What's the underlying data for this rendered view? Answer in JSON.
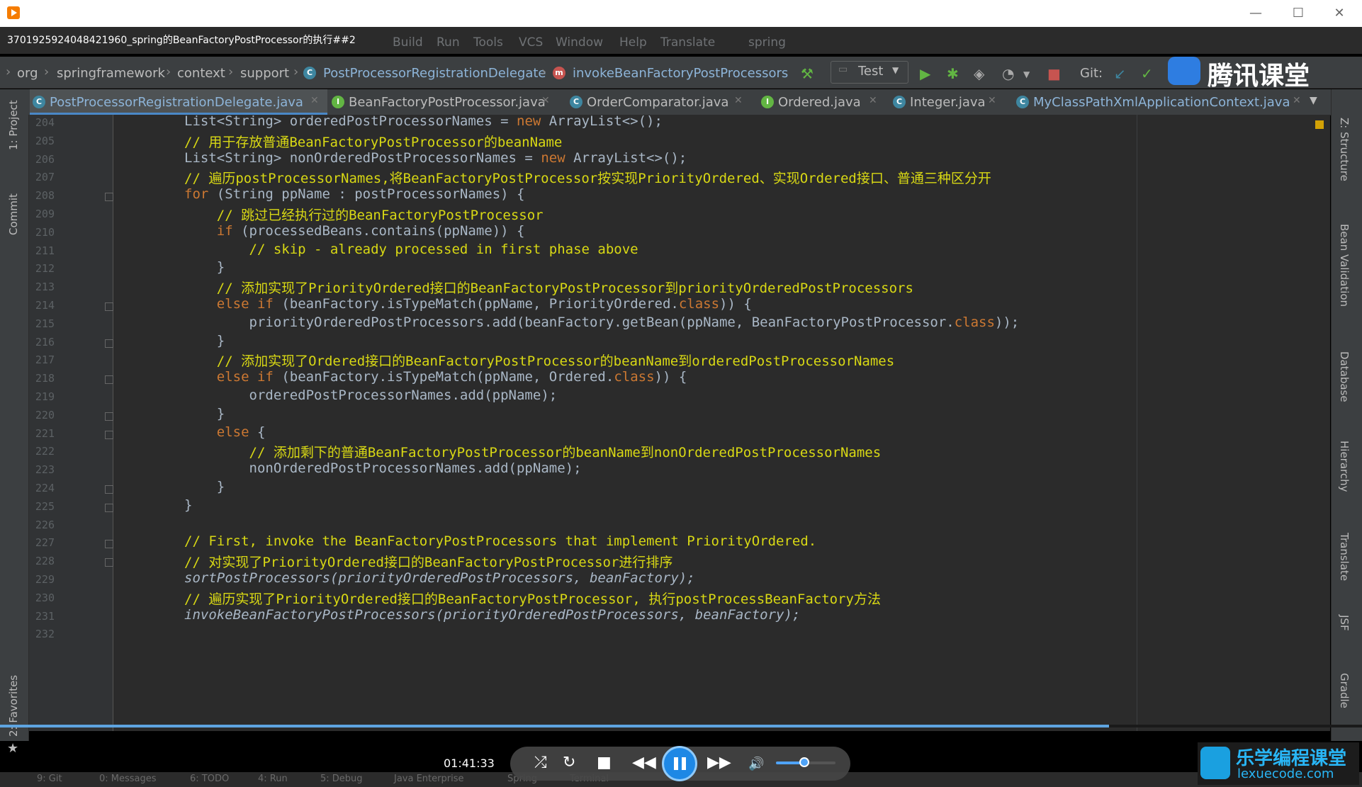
{
  "player": {
    "title": "3701925924048421960_spring的BeanFactoryPostProcessor的执行##2",
    "time": "01:41:33",
    "progress": 0.814,
    "volume": 0.48,
    "win_controls": [
      "—",
      "☐",
      "✕"
    ]
  },
  "ide": {
    "menu": [
      "Build",
      "Run",
      "Tools",
      "VCS",
      "Window",
      "Help",
      "Translate",
      "spring"
    ],
    "breadcrumbs": [
      "org",
      "springframework",
      "context",
      "support",
      "PostProcessorRegistrationDelegate",
      "invokeBeanFactoryPostProcessors"
    ],
    "run_config": "Test",
    "git_label": "Git:",
    "tabs": [
      {
        "label": "PostProcessorRegistrationDelegate.java",
        "icon": "C",
        "active": true
      },
      {
        "label": "BeanFactoryPostProcessor.java",
        "icon": "I",
        "active": false
      },
      {
        "label": "OrderComparator.java",
        "icon": "C",
        "active": false
      },
      {
        "label": "Ordered.java",
        "icon": "I",
        "active": false
      },
      {
        "label": "Integer.java",
        "icon": "C",
        "active": false
      },
      {
        "label": "MyClassPathXmlApplicationContext.java",
        "icon": "C",
        "active": false
      }
    ],
    "left_tools": [
      "1: Project",
      "Commit",
      "2: Favorites"
    ],
    "right_tools": [
      "Z: Structure",
      "Bean Validation",
      "Database",
      "Hierarchy",
      "Translate",
      "JSF",
      "Gradle"
    ],
    "line_numbers": [
      "204",
      "205",
      "206",
      "207",
      "208",
      "209",
      "210",
      "211",
      "212",
      "213",
      "214",
      "215",
      "216",
      "217",
      "218",
      "219",
      "220",
      "221",
      "222",
      "223",
      "224",
      "225",
      "226",
      "227",
      "228",
      "229",
      "230",
      "231",
      "232"
    ],
    "code_lines": [
      "List<String> orderedPostProcessorNames = new ArrayList<>();",
      "// 用于存放普通BeanFactoryPostProcessor的beanName",
      "List<String> nonOrderedPostProcessorNames = new ArrayList<>();",
      "// 遍历postProcessorNames,将BeanFactoryPostProcessor按实现PriorityOrdered、实现Ordered接口、普通三种区分开",
      "for (String ppName : postProcessorNames) {",
      "    // 跳过已经执行过的BeanFactoryPostProcessor",
      "    if (processedBeans.contains(ppName)) {",
      "        // skip - already processed in first phase above",
      "    }",
      "    // 添加实现了PriorityOrdered接口的BeanFactoryPostProcessor到priorityOrderedPostProcessors",
      "    else if (beanFactory.isTypeMatch(ppName, PriorityOrdered.class)) {",
      "        priorityOrderedPostProcessors.add(beanFactory.getBean(ppName, BeanFactoryPostProcessor.class));",
      "    }",
      "    // 添加实现了Ordered接口的BeanFactoryPostProcessor的beanName到orderedPostProcessorNames",
      "    else if (beanFactory.isTypeMatch(ppName, Ordered.class)) {",
      "        orderedPostProcessorNames.add(ppName);",
      "    }",
      "    else {",
      "        // 添加剩下的普通BeanFactoryPostProcessor的beanName到nonOrderedPostProcessorNames",
      "        nonOrderedPostProcessorNames.add(ppName);",
      "    }",
      "}",
      "",
      "// First, invoke the BeanFactoryPostProcessors that implement PriorityOrdered.",
      "// 对实现了PriorityOrdered接口的BeanFactoryPostProcessor进行排序",
      "sortPostProcessors(priorityOrderedPostProcessors, beanFactory);",
      "// 遍历实现了PriorityOrdered接口的BeanFactoryPostProcessor, 执行postProcessBeanFactory方法",
      "invokeBeanFactoryPostProcessors(priorityOrderedPostProcessors, beanFactory);",
      ""
    ],
    "status_items": [
      "9: Git",
      "0: Messages",
      "6: TODO",
      "4: Run",
      "5: Debug",
      "Java Enterprise",
      "Spring",
      "Terminal"
    ]
  },
  "watermarks": {
    "tencent": "腾讯课堂",
    "lexue_cn": "乐学编程课堂",
    "lexue_url": "lexuecode.com"
  },
  "colors": {
    "keyword": "#cc7832",
    "comment_highlight": "#d8d814",
    "accent": "#4a88c7",
    "watermark_blue": "#29b6f6"
  }
}
